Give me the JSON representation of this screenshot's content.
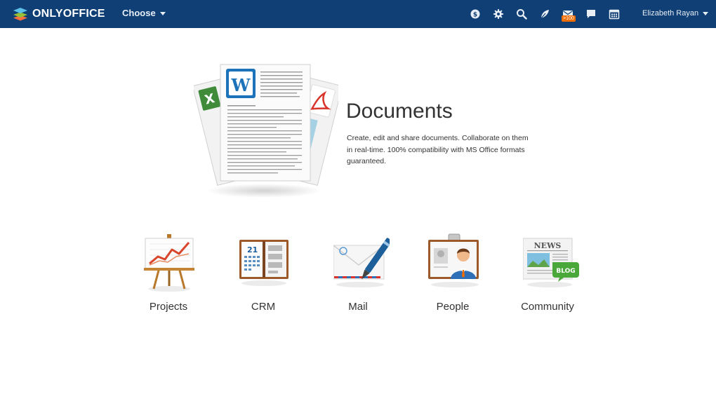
{
  "header": {
    "brand": "ONLYOFFICE",
    "choose_label": "Choose",
    "mail_badge": ">100",
    "user_name": "Elizabeth Rayan",
    "icons": [
      "payments-icon",
      "settings-icon",
      "search-icon",
      "feed-icon",
      "mail-icon",
      "chat-icon",
      "calendar-icon"
    ]
  },
  "hero": {
    "title": "Documents",
    "description": "Create, edit and share documents. Collaborate on them in real-time. 100% compatibility with MS Office formats guaranteed."
  },
  "modules": [
    {
      "label": "Projects"
    },
    {
      "label": "CRM"
    },
    {
      "label": "Mail"
    },
    {
      "label": "People"
    },
    {
      "label": "Community"
    }
  ],
  "colors": {
    "topbar": "#0f3f75",
    "accent_orange": "#ef6c00",
    "text": "#333333"
  }
}
